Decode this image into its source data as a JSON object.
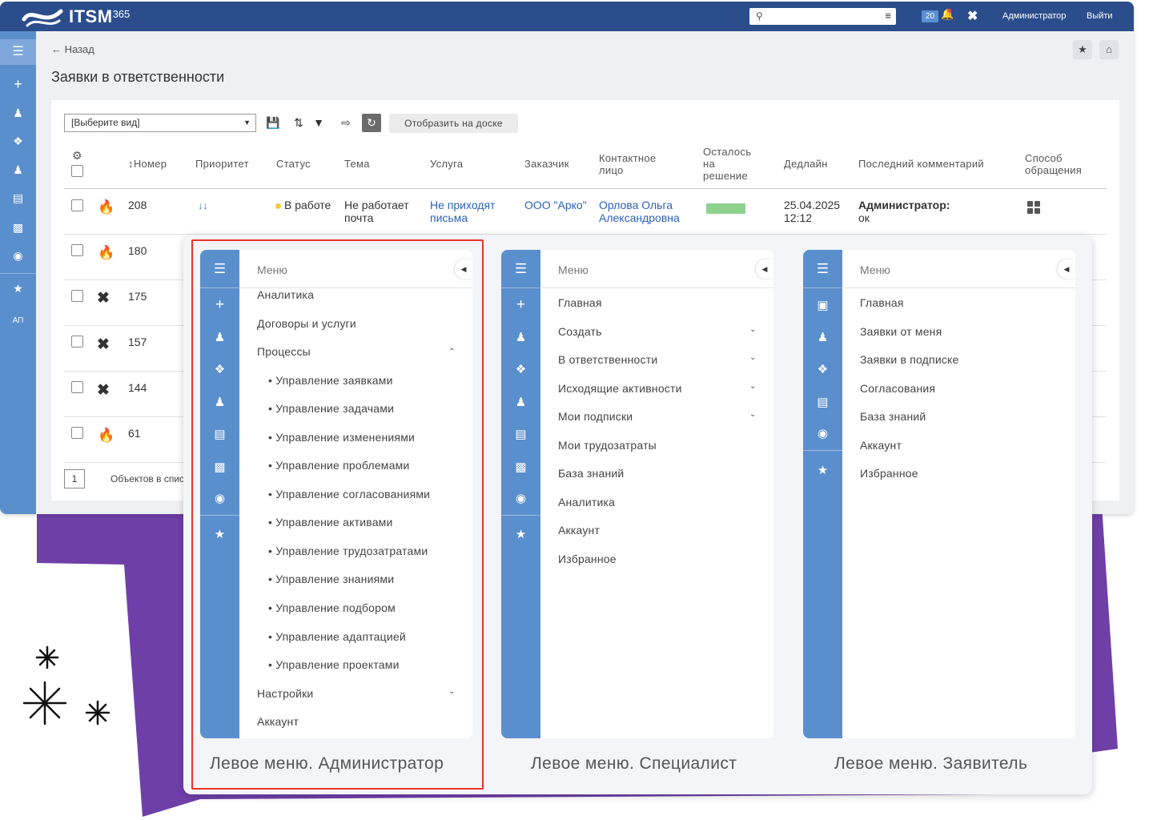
{
  "brand": {
    "name": "ITSM",
    "sup": "365"
  },
  "topbar": {
    "notifications": "20",
    "user": "Администратор",
    "logout": "Выйти"
  },
  "page": {
    "back": "← Назад",
    "title": "Заявки в ответственности"
  },
  "toolbar": {
    "view_select": "[Выберите вид]",
    "board_button": "Отобразить на доске"
  },
  "table": {
    "headers": {
      "number": "Номер",
      "priority": "Приоритет",
      "status": "Статус",
      "topic": "Тема",
      "service": "Услуга",
      "customer": "Заказчик",
      "contact_1": "Контактное",
      "contact_2": "лицо",
      "remaining_1": "Осталось",
      "remaining_2": "на",
      "remaining_3": "решение",
      "deadline": "Дедлайн",
      "comment": "Последний комментарий",
      "method_1": "Способ",
      "method_2": "обращения"
    },
    "row1": {
      "number": "208",
      "status": "В работе",
      "topic_1": "Не работает",
      "topic_2": "почта",
      "service_1": "Не приходят",
      "service_2": "письма",
      "customer": "ООО \"Арко\"",
      "contact_1": "Орлова Ольга",
      "contact_2": "Александровна",
      "deadline_1": "25.04.2025",
      "deadline_2": "12:12",
      "comment_author": "Администратор:",
      "comment_text": "ок",
      "remaining_fraction": 1.0
    },
    "rows": [
      "180",
      "175",
      "157",
      "144",
      "61"
    ],
    "pager": "1",
    "pager_text": "Объектов в спис"
  },
  "admin_menu": {
    "header": "Меню",
    "items": [
      "Аналитика",
      "Договоры и услуги",
      "Процессы"
    ],
    "sub_items": [
      "• Управление заявками",
      "• Управление задачами",
      "• Управление изменениями",
      "• Управление проблемами",
      "• Управление согласованиями",
      "• Управление активами",
      "• Управление трудозатратами",
      "• Управление знаниями",
      "• Управление подбором",
      "• Управление адаптацией",
      "• Управление проектами"
    ],
    "tail_items": [
      "Настройки",
      "Аккаунт"
    ],
    "caption": "Левое меню. Администратор"
  },
  "specialist_menu": {
    "header": "Меню",
    "items": [
      "Главная",
      "Создать",
      "В ответственности",
      "Исходящие активности",
      "Мои подписки",
      "Мои трудозатраты",
      "База знаний",
      "Аналитика",
      "Аккаунт",
      "Избранное"
    ],
    "caption": "Левое меню. Специалист"
  },
  "requester_menu": {
    "header": "Меню",
    "items": [
      "Главная",
      "Заявки от меня",
      "Заявки в подписке",
      "Согласования",
      "База знаний",
      "Аккаунт",
      "Избранное"
    ],
    "caption": "Левое меню. Заявитель"
  },
  "sidenav_label": "АП",
  "colors": {
    "topbar": "#2b4d8c",
    "sidebar": "#5a8fce",
    "purple": "#6f3fa8",
    "highlight": "#e8342a",
    "link": "#2b62b7"
  }
}
